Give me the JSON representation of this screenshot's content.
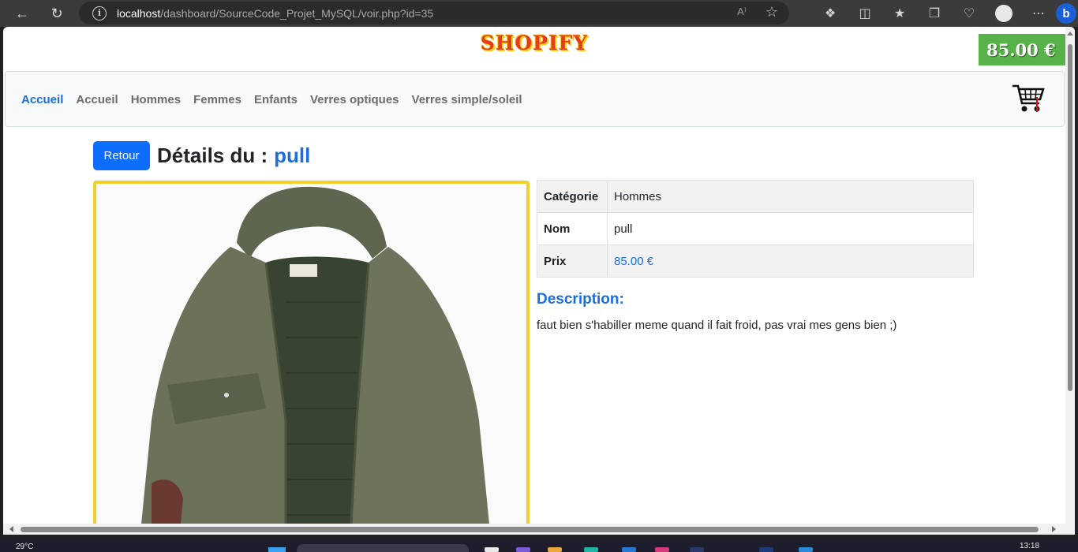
{
  "browser": {
    "url_host": "localhost",
    "url_path": "/dashboard/SourceCode_Projet_MySQL/voir.php?id=35",
    "read_aloud": "A⁾",
    "back_icon": "back-arrow-icon",
    "reload_icon": "reload-icon"
  },
  "header": {
    "brand": "SHOPIFY",
    "cart_total": "85.00 €"
  },
  "nav": {
    "items": [
      "Accueil",
      "Accueil",
      "Hommes",
      "Femmes",
      "Enfants",
      "Verres optiques",
      "Verres simple/soleil"
    ],
    "active_index": 0
  },
  "product": {
    "back_button": "Retour",
    "title_prefix": "Détails du :",
    "name": "pull",
    "details": [
      {
        "label": "Catégorie",
        "value": "Hommes"
      },
      {
        "label": "Nom",
        "value": "pull"
      },
      {
        "label": "Prix",
        "value": "85.00 €"
      }
    ],
    "description_heading": "Description:",
    "description": "faut bien s'habiller meme quand il fait froid, pas vrai mes gens bien ;)"
  },
  "taskbar": {
    "weather": "29°C",
    "time": "13:18"
  },
  "colors": {
    "accent": "#1a6fe0",
    "primary_button": "#0d6efd",
    "cart_badge": "#58b24a",
    "image_border": "#f3cf29",
    "brand_red": "#e63b1f"
  }
}
